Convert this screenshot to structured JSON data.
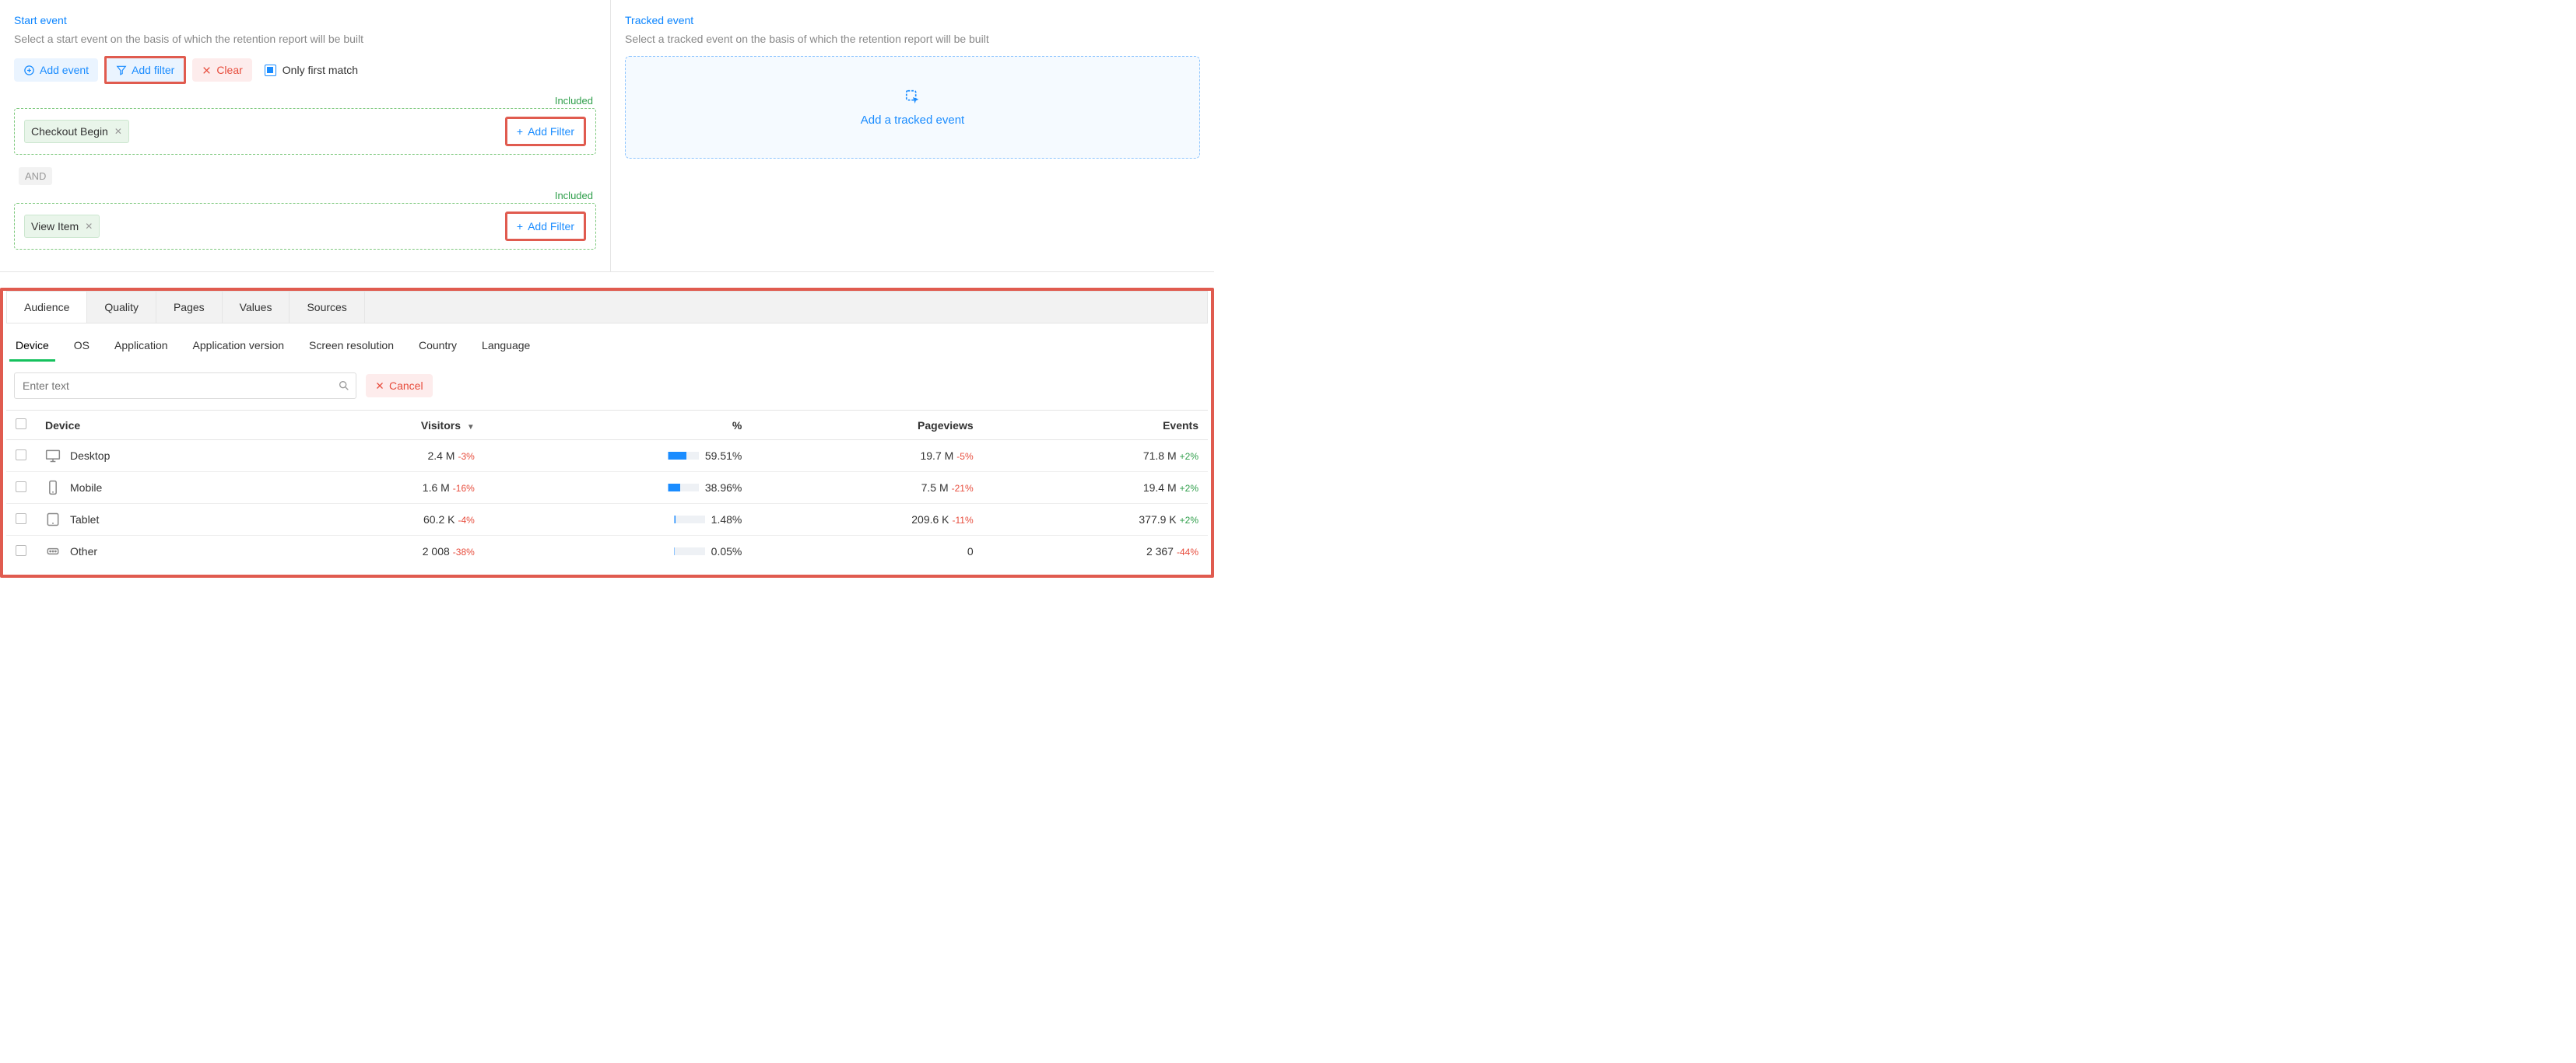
{
  "start": {
    "title": "Start event",
    "desc": "Select a start event on the basis of which the retention report will be built",
    "addEvent": "Add event",
    "addFilter": "Add filter",
    "clear": "Clear",
    "onlyFirst": "Only first match",
    "included": "Included",
    "addFilterInline": "Add Filter",
    "and": "AND",
    "events": [
      {
        "name": "Checkout Begin"
      },
      {
        "name": "View Item"
      }
    ]
  },
  "tracked": {
    "title": "Tracked event",
    "desc": "Select a tracked event on the basis of which the retention report will be built",
    "dropText": "Add a tracked event"
  },
  "mainTabs": [
    "Audience",
    "Quality",
    "Pages",
    "Values",
    "Sources"
  ],
  "subTabs": [
    "Device",
    "OS",
    "Application",
    "Application version",
    "Screen resolution",
    "Country",
    "Language"
  ],
  "searchPlaceholder": "Enter text",
  "cancel": "Cancel",
  "columns": {
    "device": "Device",
    "visitors": "Visitors",
    "percent": "%",
    "pageviews": "Pageviews",
    "events": "Events"
  },
  "rows": [
    {
      "device": "Desktop",
      "icon": "desktop",
      "visitors": "2.4 M",
      "visitorsDelta": "-3%",
      "percent": 59.51,
      "percentLabel": "59.51%",
      "pageviews": "19.7 M",
      "pageviewsDelta": "-5%",
      "events": "71.8 M",
      "eventsDelta": "+2%",
      "eventsDeltaPositive": true
    },
    {
      "device": "Mobile",
      "icon": "mobile",
      "visitors": "1.6 M",
      "visitorsDelta": "-16%",
      "percent": 38.96,
      "percentLabel": "38.96%",
      "pageviews": "7.5 M",
      "pageviewsDelta": "-21%",
      "events": "19.4 M",
      "eventsDelta": "+2%",
      "eventsDeltaPositive": true
    },
    {
      "device": "Tablet",
      "icon": "tablet",
      "visitors": "60.2 K",
      "visitorsDelta": "-4%",
      "percent": 1.48,
      "percentLabel": "1.48%",
      "pageviews": "209.6 K",
      "pageviewsDelta": "-11%",
      "events": "377.9 K",
      "eventsDelta": "+2%",
      "eventsDeltaPositive": true
    },
    {
      "device": "Other",
      "icon": "other",
      "visitors": "2 008",
      "visitorsDelta": "-38%",
      "percent": 0.05,
      "percentLabel": "0.05%",
      "pageviews": "0",
      "pageviewsDelta": "",
      "events": "2 367",
      "eventsDelta": "-44%",
      "eventsDeltaPositive": false
    }
  ]
}
